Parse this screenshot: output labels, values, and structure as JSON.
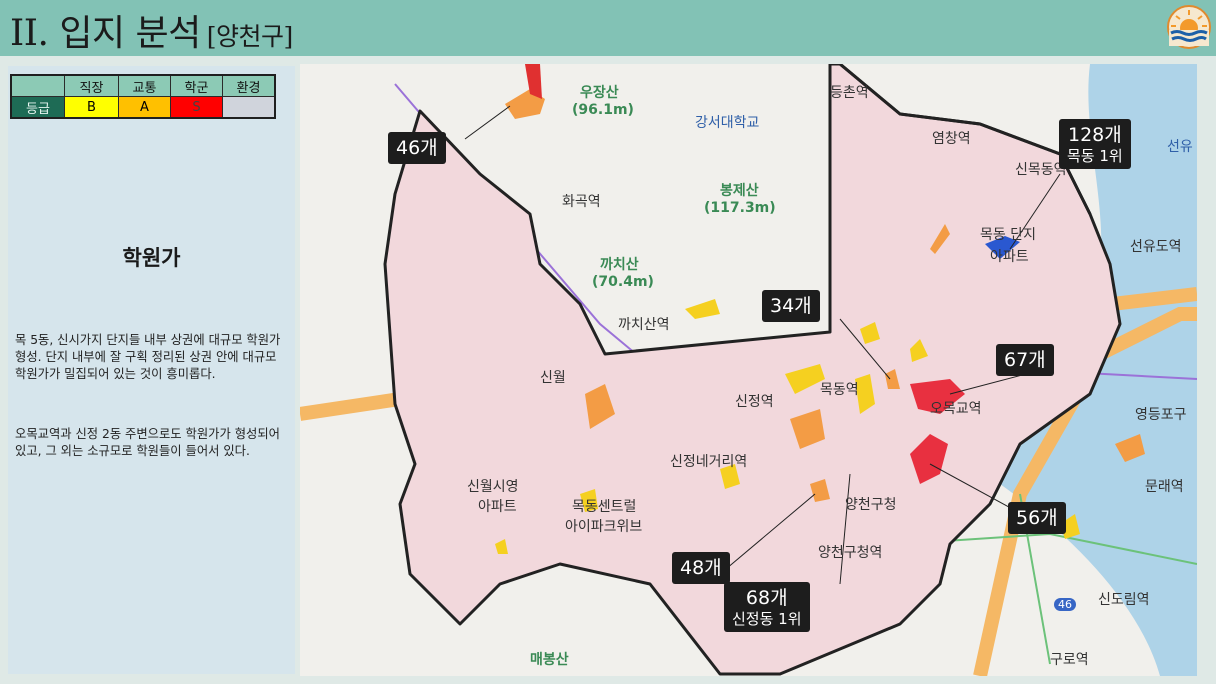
{
  "header": {
    "title": "II. 입지 분석",
    "subtitle": "[양천구]"
  },
  "grade_table": {
    "columns": [
      "직장",
      "교통",
      "학군",
      "환경"
    ],
    "row_label": "등급",
    "grades": [
      "B",
      "A",
      "S",
      ""
    ]
  },
  "section": {
    "title": "학원가",
    "paragraph1": "목 5동, 신시가지 단지들 내부 상권에 대규모 학원가 형성. 단지 내부에 잘 구획 정리된 상권 안에 대규모 학원가가 밀집되어 있는 것이 흥미롭다.",
    "paragraph2": "오목교역과 신정 2동 주변으로도 학원가가 형성되어 있고, 그 외는 소규모로 학원들이 들어서 있다."
  },
  "map": {
    "labels": [
      {
        "count": "46개",
        "sub": ""
      },
      {
        "count": "128개",
        "sub": "목동 1위"
      },
      {
        "count": "34개",
        "sub": ""
      },
      {
        "count": "67개",
        "sub": ""
      },
      {
        "count": "56개",
        "sub": ""
      },
      {
        "count": "48개",
        "sub": ""
      },
      {
        "count": "68개",
        "sub": "신정동 1위"
      }
    ],
    "places": [
      {
        "name": "우장산"
      },
      {
        "name": "(96.1m)"
      },
      {
        "name": "강서대학교"
      },
      {
        "name": "등촌역"
      },
      {
        "name": "염창역"
      },
      {
        "name": "화곡역"
      },
      {
        "name": "봉제산"
      },
      {
        "name": "(117.3m)"
      },
      {
        "name": "까치산"
      },
      {
        "name": "(70.4m)"
      },
      {
        "name": "까치산역"
      },
      {
        "name": "신월"
      },
      {
        "name": "신목동역"
      },
      {
        "name": "목동 단지"
      },
      {
        "name": "아파트"
      },
      {
        "name": "선유도역"
      },
      {
        "name": "신정역"
      },
      {
        "name": "목동역"
      },
      {
        "name": "오목교역"
      },
      {
        "name": "영등포구"
      },
      {
        "name": "신정네거리역"
      },
      {
        "name": "신월시영"
      },
      {
        "name": "아파트"
      },
      {
        "name": "목동센트럴"
      },
      {
        "name": "아이파크위브"
      },
      {
        "name": "양천구청"
      },
      {
        "name": "문래역"
      },
      {
        "name": "양천구청역"
      },
      {
        "name": "신도림역"
      },
      {
        "name": "구로역"
      },
      {
        "name": "매봉산"
      },
      {
        "name": "선유"
      },
      {
        "name": "46"
      }
    ]
  },
  "colors": {
    "header_bg": "#82c2b5",
    "district_fill": "#f2d8dc",
    "boundary": "#222222",
    "road": "#f5b865",
    "subway_purple": "#9b72d8",
    "subway_green": "#6cc27a"
  }
}
